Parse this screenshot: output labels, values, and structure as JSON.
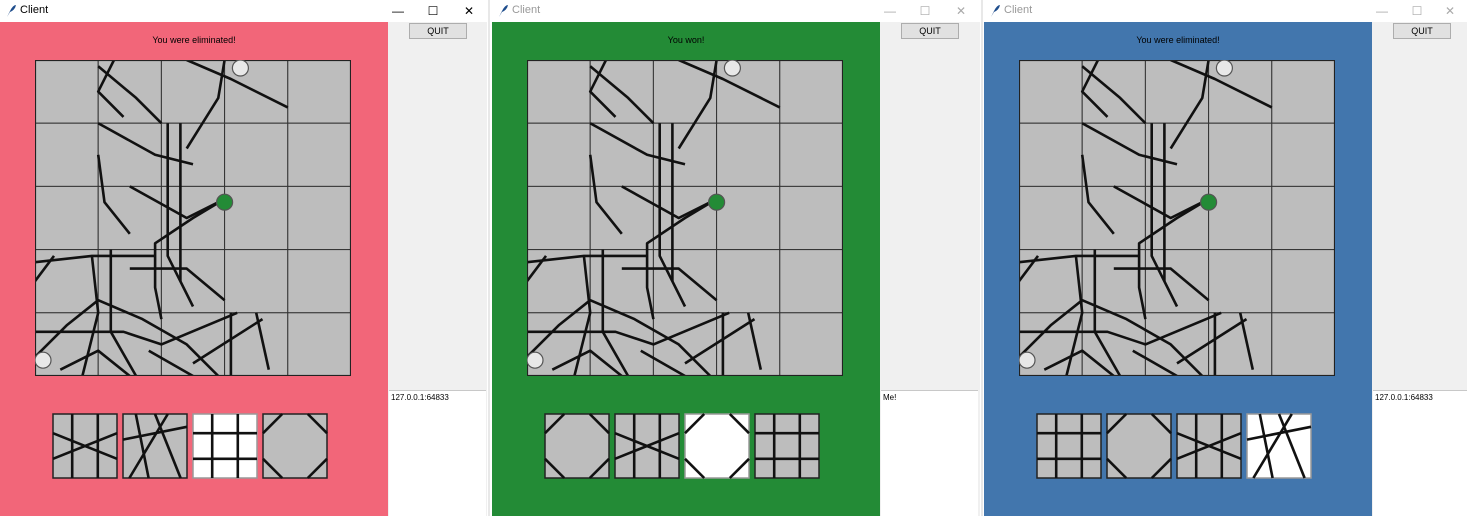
{
  "windows": [
    {
      "title": "Client",
      "bg_color": "#f26679",
      "status": "You were eliminated!",
      "quit_label": "QUIT",
      "log_text": "127.0.0.1:64833",
      "active": true,
      "hand": [
        {
          "highlight": false,
          "pattern": "slash"
        },
        {
          "highlight": false,
          "pattern": "cross"
        },
        {
          "highlight": true,
          "pattern": "grid"
        },
        {
          "highlight": false,
          "pattern": "octa"
        }
      ]
    },
    {
      "title": "Client",
      "bg_color": "#238b36",
      "status": "You won!",
      "quit_label": "QUIT",
      "log_text": "Me!",
      "active": false,
      "hand": [
        {
          "highlight": false,
          "pattern": "octa"
        },
        {
          "highlight": false,
          "pattern": "slash"
        },
        {
          "highlight": true,
          "pattern": "octa"
        },
        {
          "highlight": false,
          "pattern": "grid"
        }
      ]
    },
    {
      "title": "Client",
      "bg_color": "#4276ad",
      "status": "You were eliminated!",
      "quit_label": "QUIT",
      "log_text": "127.0.0.1:64833",
      "active": false,
      "hand": [
        {
          "highlight": false,
          "pattern": "grid"
        },
        {
          "highlight": false,
          "pattern": "octa"
        },
        {
          "highlight": false,
          "pattern": "slash"
        },
        {
          "highlight": true,
          "pattern": "cross"
        }
      ]
    }
  ],
  "colors": {
    "tile": "#bdbdbd",
    "tile_highlight": "#ffffff",
    "line": "#111111",
    "token_active": "#238b36",
    "token_eliminated": "#e8e8e8"
  },
  "icons": {
    "app": "feather-icon",
    "minimize": "minimize-icon",
    "maximize": "maximize-icon",
    "close": "close-icon"
  }
}
